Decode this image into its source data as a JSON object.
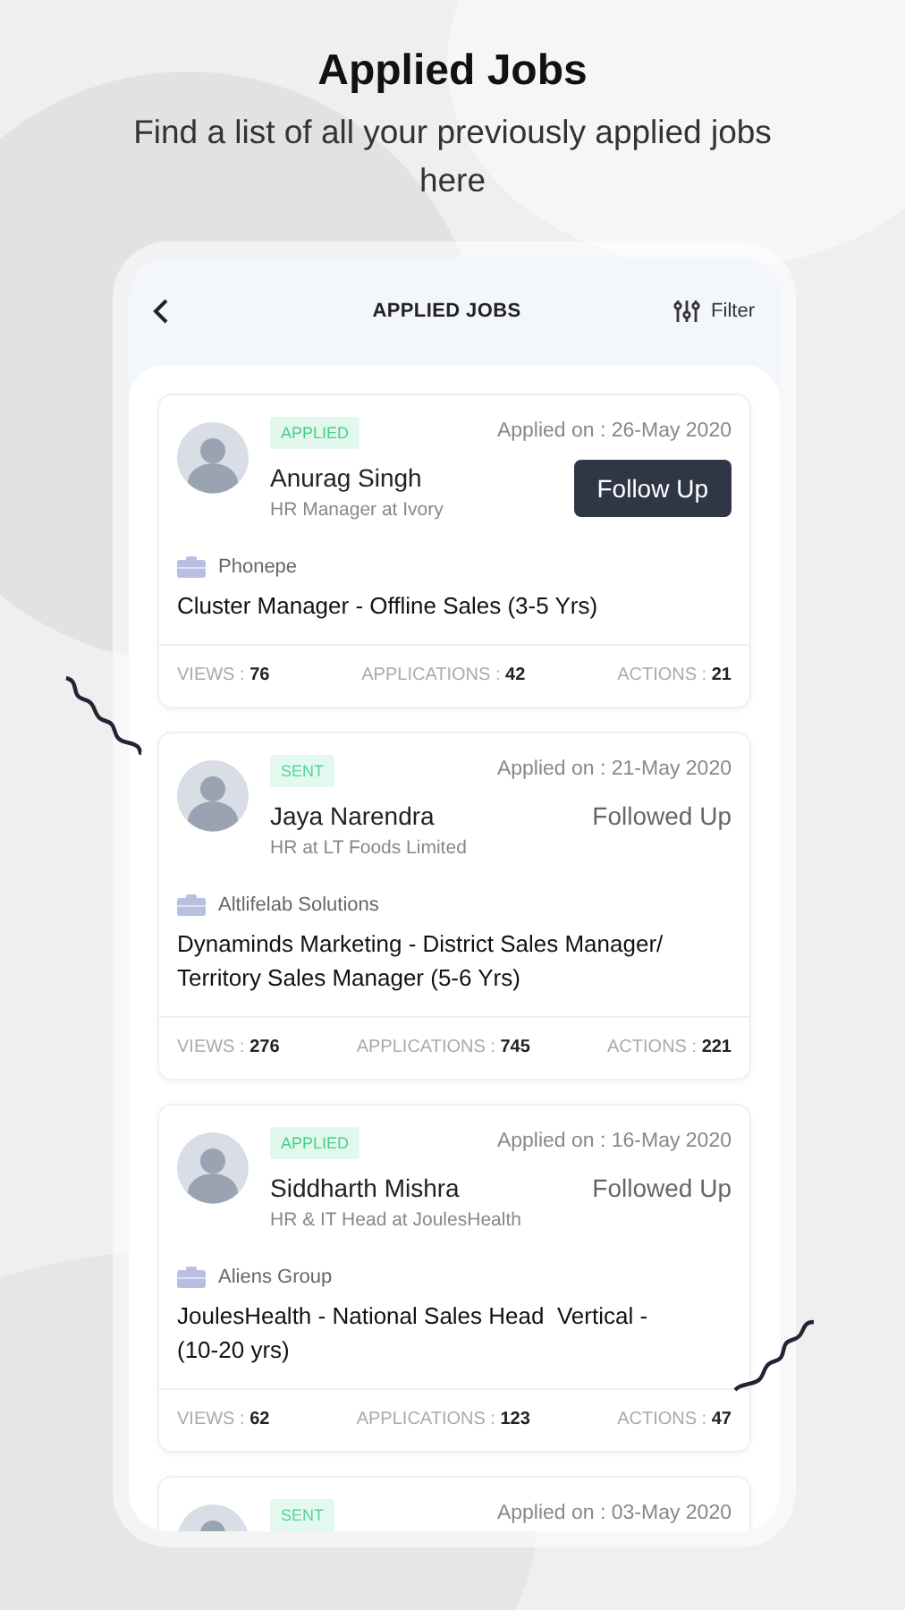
{
  "heading": {
    "title": "Applied Jobs",
    "subtitle": "Find a list of all your previously applied jobs here"
  },
  "screen": {
    "title": "APPLIED JOBS",
    "filter_label": "Filter"
  },
  "applications": [
    {
      "status": {
        "label": "APPLIED",
        "kind": "applied"
      },
      "applied_on": "Applied on : 26-May 2020",
      "recruiter": {
        "name": "Anurag Singh",
        "role": "HR Manager at Ivory"
      },
      "action": {
        "kind": "button",
        "label": "Follow Up"
      },
      "company": "Phonepe",
      "job_title": "Cluster Manager - Offline Sales (3-5 Yrs)",
      "stats": [
        {
          "label": "VIEWS :",
          "value": "76"
        },
        {
          "label": "APPLICATIONS :",
          "value": "42"
        },
        {
          "label": "ACTIONS :",
          "value": "21"
        }
      ]
    },
    {
      "status": {
        "label": "SENT",
        "kind": "sent"
      },
      "applied_on": "Applied on : 21-May 2020",
      "recruiter": {
        "name": "Jaya Narendra",
        "role": "HR at LT Foods Limited"
      },
      "action": {
        "kind": "text",
        "label": "Followed Up"
      },
      "company": "Altlifelab Solutions",
      "job_title": "Dynaminds Marketing - District Sales Manager/ Territory Sales Manager (5-6 Yrs)",
      "stats": [
        {
          "label": "VIEWS :",
          "value": "276"
        },
        {
          "label": "APPLICATIONS :",
          "value": "745"
        },
        {
          "label": "ACTIONS :",
          "value": "221"
        }
      ]
    },
    {
      "status": {
        "label": "APPLIED",
        "kind": "applied"
      },
      "applied_on": "Applied on : 16-May 2020",
      "recruiter": {
        "name": "Siddharth Mishra",
        "role": "HR & IT Head at JoulesHealth"
      },
      "action": {
        "kind": "text",
        "label": "Followed Up"
      },
      "company": "Aliens Group",
      "job_title": "JoulesHealth - National Sales Head  Vertical - (10-20 yrs)",
      "stats": [
        {
          "label": "VIEWS :",
          "value": "62"
        },
        {
          "label": "APPLICATIONS :",
          "value": "123"
        },
        {
          "label": "ACTIONS :",
          "value": "47"
        }
      ]
    },
    {
      "status": {
        "label": "SENT",
        "kind": "sent"
      },
      "applied_on": "Applied on : 03-May 2020"
    }
  ]
}
